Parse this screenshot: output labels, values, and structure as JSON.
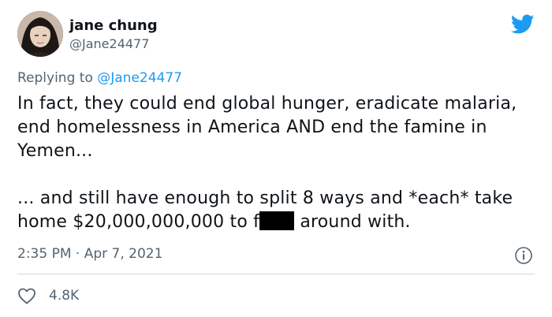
{
  "author": {
    "display_name": "jane chung",
    "handle": "@Jane24477",
    "avatar": "avatar-photo"
  },
  "reply": {
    "prefix": "Replying to ",
    "handle": "@Jane24477"
  },
  "tweet": {
    "paragraph1": "In fact, they could end global hunger, eradicate malaria, end homelessness in America AND end the famine in Yemen...",
    "paragraph2_before": "... and still have enough to split 8 ways and *each* take home $20,000,000,000 to f",
    "paragraph2_after": " around with."
  },
  "meta": {
    "timestamp": "2:35 PM · Apr 7, 2021"
  },
  "engagement": {
    "likes": "4.8K"
  },
  "icons": {
    "brand": "twitter-bird-icon",
    "info": "info-icon",
    "like": "heart-icon"
  },
  "colors": {
    "brand_blue": "#1d9bf0",
    "secondary_text": "#536471",
    "primary_text": "#0f1419",
    "divider": "#cfd9de",
    "redaction": "#000000"
  }
}
